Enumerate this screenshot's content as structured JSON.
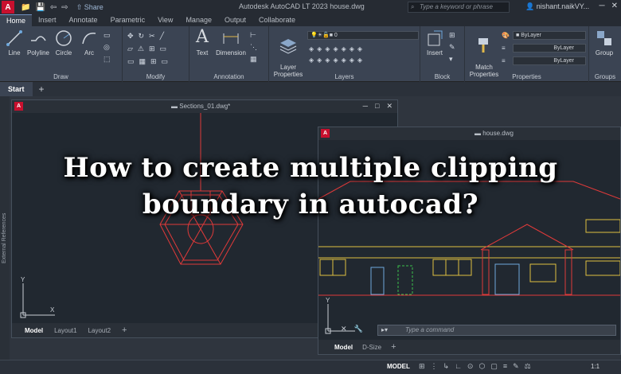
{
  "titlebar": {
    "app_icon": "A",
    "quick_access": [
      "📁",
      "💾",
      "⇦",
      "⇨"
    ],
    "share_label": "Share",
    "title": "Autodesk AutoCAD LT 2023    house.dwg",
    "search_placeholder": "Type a keyword or phrase",
    "user": "nishant.naikVY..."
  },
  "ribbon_tabs": [
    "Home",
    "Insert",
    "Annotate",
    "Parametric",
    "View",
    "Manage",
    "Output",
    "Collaborate"
  ],
  "ribbon": {
    "draw": {
      "title": "Draw",
      "tools": [
        "Line",
        "Polyline",
        "Circle",
        "Arc"
      ]
    },
    "modify": {
      "title": "Modify"
    },
    "annotation": {
      "title": "Annotation",
      "tools": [
        "Text",
        "Dimension"
      ]
    },
    "layers": {
      "title": "Layers",
      "tool": "Layer\nProperties",
      "layer_value": "0"
    },
    "block": {
      "title": "Block",
      "tool": "Insert"
    },
    "properties": {
      "title": "Properties",
      "tool": "Match\nProperties",
      "bylayer": [
        "ByLayer",
        "ByLayer",
        "ByLayer"
      ]
    },
    "groups": {
      "title": "Groups",
      "tool": "Group"
    }
  },
  "file_tabs": {
    "start": "Start"
  },
  "sidebar_label": "External References",
  "drawing1": {
    "name": "Sections_01.dwg*",
    "layout_tabs": [
      "Model",
      "Layout1",
      "Layout2"
    ]
  },
  "drawing2": {
    "name": "house.dwg",
    "command_placeholder": "Type a command",
    "layout_tabs": [
      "Model",
      "D-Size"
    ]
  },
  "status": {
    "model": "MODEL",
    "scale": "1:1"
  },
  "headline": "How to create multiple clipping boundary in autocad?"
}
